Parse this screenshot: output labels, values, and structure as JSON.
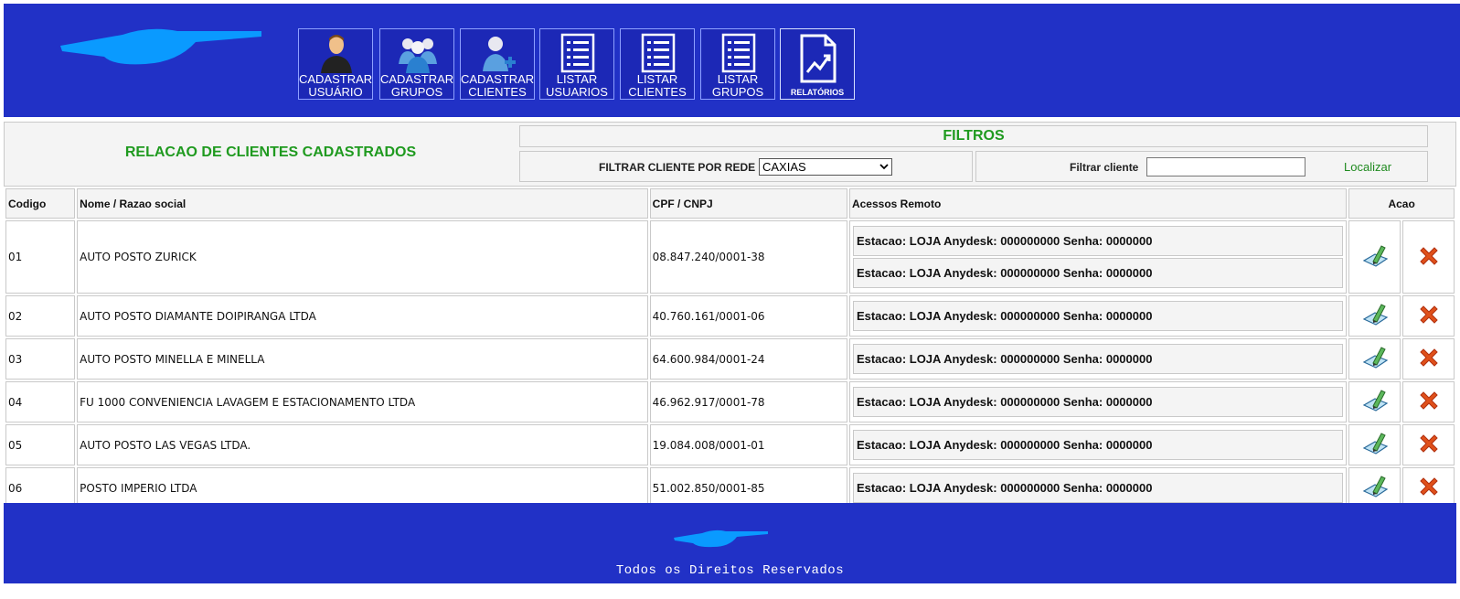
{
  "header": {
    "nav": [
      {
        "line1": "CADASTRAR",
        "line2": "USUÁRIO",
        "icon": "user-icon"
      },
      {
        "line1": "CADASTRAR",
        "line2": "GRUPOS",
        "icon": "group-icon"
      },
      {
        "line1": "CADASTRAR",
        "line2": "CLIENTES",
        "icon": "add-client-icon"
      },
      {
        "line1": "LISTAR",
        "line2": "USUARIOS",
        "icon": "list-icon"
      },
      {
        "line1": "LISTAR",
        "line2": "CLIENTES",
        "icon": "list-icon"
      },
      {
        "line1": "LISTAR",
        "line2": "GRUPOS",
        "icon": "list-icon"
      },
      {
        "line1": "RELATÓRIOS",
        "line2": "",
        "icon": "report-icon"
      }
    ]
  },
  "page_title": "RELACAO DE CLIENTES CADASTRADOS",
  "filters": {
    "heading": "FILTROS",
    "rede_label": "FILTRAR CLIENTE POR REDE",
    "rede_selected": "CAXIAS",
    "cliente_label": "Filtrar cliente",
    "cliente_value": "",
    "search_label": "Localizar"
  },
  "table": {
    "headers": {
      "codigo": "Codigo",
      "nome": "Nome / Razao social",
      "cpf": "CPF / CNPJ",
      "acessos": "Acessos Remoto",
      "acao": "Acao"
    },
    "rows": [
      {
        "codigo": "01",
        "nome": "AUTO POSTO ZURICK",
        "cpf": "08.847.240/0001-38",
        "acessos": [
          "Estacao: LOJA Anydesk: 000000000 Senha: 0000000",
          "Estacao: LOJA Anydesk: 000000000 Senha: 0000000"
        ]
      },
      {
        "codigo": "02",
        "nome": "AUTO POSTO DIAMANTE DOIPIRANGA LTDA",
        "cpf": "40.760.161/0001-06",
        "acessos": [
          "Estacao: LOJA Anydesk: 000000000 Senha: 0000000"
        ]
      },
      {
        "codigo": "03",
        "nome": "AUTO POSTO MINELLA E MINELLA",
        "cpf": "64.600.984/0001-24",
        "acessos": [
          "Estacao: LOJA Anydesk: 000000000 Senha: 0000000"
        ]
      },
      {
        "codigo": "04",
        "nome": "FU 1000 CONVENIENCIA LAVAGEM E ESTACIONAMENTO LTDA",
        "cpf": "46.962.917/0001-78",
        "acessos": [
          "Estacao: LOJA Anydesk: 000000000 Senha: 0000000"
        ]
      },
      {
        "codigo": "05",
        "nome": "AUTO POSTO LAS VEGAS LTDA.",
        "cpf": "19.084.008/0001-01",
        "acessos": [
          "Estacao: LOJA Anydesk: 000000000 Senha: 0000000"
        ]
      },
      {
        "codigo": "06",
        "nome": "POSTO IMPERIO LTDA",
        "cpf": "51.002.850/0001-85",
        "acessos": [
          "Estacao: LOJA Anydesk: 000000000 Senha: 0000000"
        ]
      }
    ]
  },
  "footer": {
    "text": "Todos os Direitos Reservados"
  },
  "colors": {
    "brand_blue": "#2131c6",
    "accent_green": "#1f9a1f",
    "delete_red": "#e0501a"
  }
}
